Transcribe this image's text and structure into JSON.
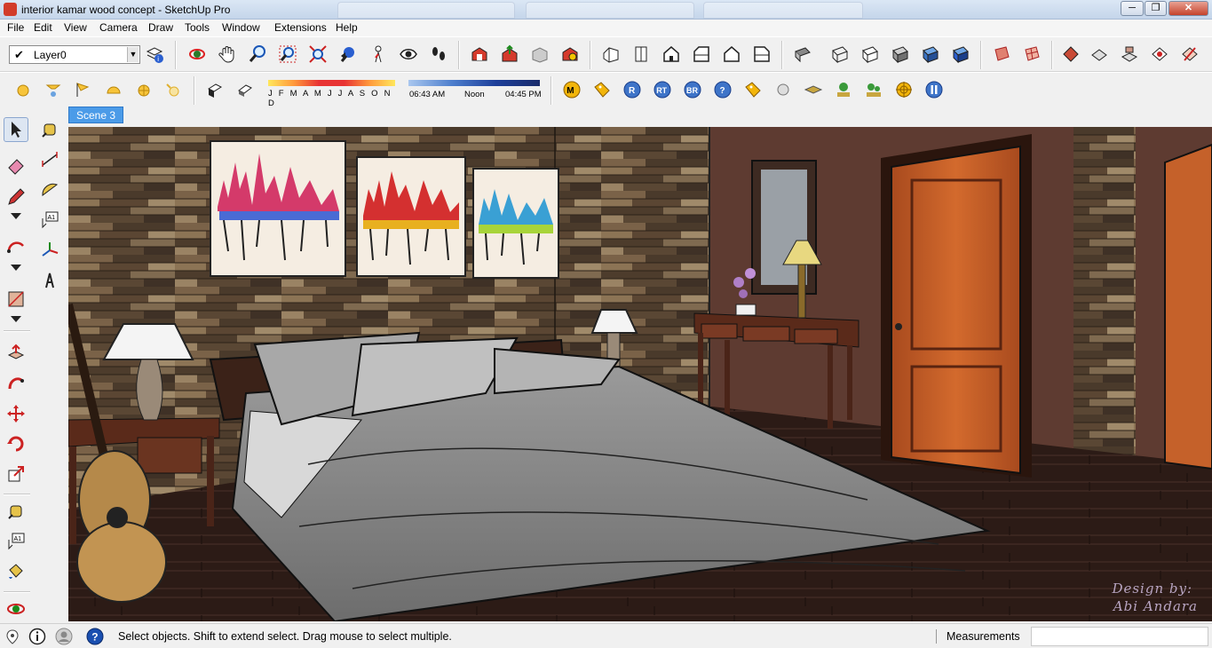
{
  "window": {
    "title": "interior kamar wood concept - SketchUp Pro",
    "controls": [
      "─",
      "❐",
      "✕"
    ]
  },
  "menu": [
    "File",
    "Edit",
    "View",
    "Camera",
    "Draw",
    "Tools",
    "Window",
    "Extensions",
    "Help"
  ],
  "layer": {
    "check": "✔",
    "name": "Layer0",
    "dropdown": "▼"
  },
  "shadow": {
    "months": "J F M A M J J A S O N D",
    "time_start": "06:43 AM",
    "time_mid": "Noon",
    "time_end": "04:45 PM"
  },
  "plugin_buttons": [
    "M",
    "R",
    "RT",
    "BR",
    "?"
  ],
  "scene": {
    "tab": "Scene 3"
  },
  "watermark": {
    "line1": "Design by:",
    "line2": "Abi Andara"
  },
  "status": {
    "hint": "Select objects. Shift to extend select. Drag mouse to select multiple.",
    "measurements_label": "Measurements",
    "measurements_value": ""
  },
  "colors": {
    "scene_tab": "#4b9be8",
    "wall_plaster": "#5e3b31",
    "door_wood": "#c5612a",
    "bedding": "#8c8c8c"
  }
}
